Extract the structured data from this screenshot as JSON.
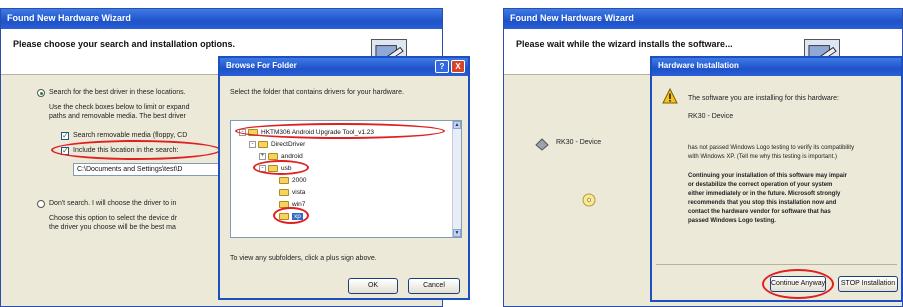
{
  "left_wizard": {
    "title": "Found New Hardware Wizard",
    "heading": "Please choose your search and installation options.",
    "option_search": "Search for the best driver in these locations.",
    "search_desc_1": "Use the check boxes below to limit or expand",
    "search_desc_2": "paths and removable media. The best driver",
    "check_removable": "Search removable media (floppy, CD",
    "check_include": "Include this location in the search:",
    "location_value": "C:\\Documents and Settings\\test\\D",
    "option_dont_search": "Don't search. I will choose the driver to in",
    "dont_desc_1": "Choose this option to select the device dr",
    "dont_desc_2": "the driver you choose will be the best ma"
  },
  "browse_dialog": {
    "title": "Browse For Folder",
    "help_label": "?",
    "close_label": "X",
    "instruction": "Select the folder that contains drivers for your hardware.",
    "tree": [
      {
        "label": "HKTM306 Android Upgrade Tool_v1.23",
        "expander": "-",
        "level": 0
      },
      {
        "label": "DirectDriver",
        "expander": "-",
        "level": 1
      },
      {
        "label": "android",
        "expander": "+",
        "level": 2
      },
      {
        "label": "usb",
        "expander": "-",
        "level": 2
      },
      {
        "label": "2000",
        "expander": "",
        "level": 3
      },
      {
        "label": "vista",
        "expander": "",
        "level": 3
      },
      {
        "label": "win7",
        "expander": "",
        "level": 3
      },
      {
        "label": "xp",
        "expander": "",
        "level": 3
      }
    ],
    "hint": "To view any subfolders, click a plus sign above.",
    "ok_label": "OK",
    "cancel_label": "Cancel"
  },
  "right_wizard": {
    "title": "Found New Hardware Wizard",
    "heading": "Please wait while the wizard installs the software...",
    "device_name": "RK30 - Device"
  },
  "hw_dialog": {
    "title": "Hardware Installation",
    "line1": "The software you are installing for this hardware:",
    "device": "RK30 - Device",
    "logo_1": "has not passed Windows Logo testing to verify its compatibility",
    "logo_2": "with Windows XP. (Tell me why this testing is important.)",
    "warn_1": "Continuing your installation of this software may impair",
    "warn_2": "or destabilize the correct operation of your system",
    "warn_3": "either immediately or in the future. Microsoft strongly",
    "warn_4": "recommends that you stop this installation now and",
    "warn_5": "contact the hardware vendor for software that has",
    "warn_6": "passed Windows Logo testing.",
    "continue_label": "Continue Anyway",
    "stop_label": "STOP Installation"
  },
  "colors": {
    "title_blue": "#1f52c8",
    "highlight_red": "#e02020",
    "selection_blue": "#316ac5"
  }
}
